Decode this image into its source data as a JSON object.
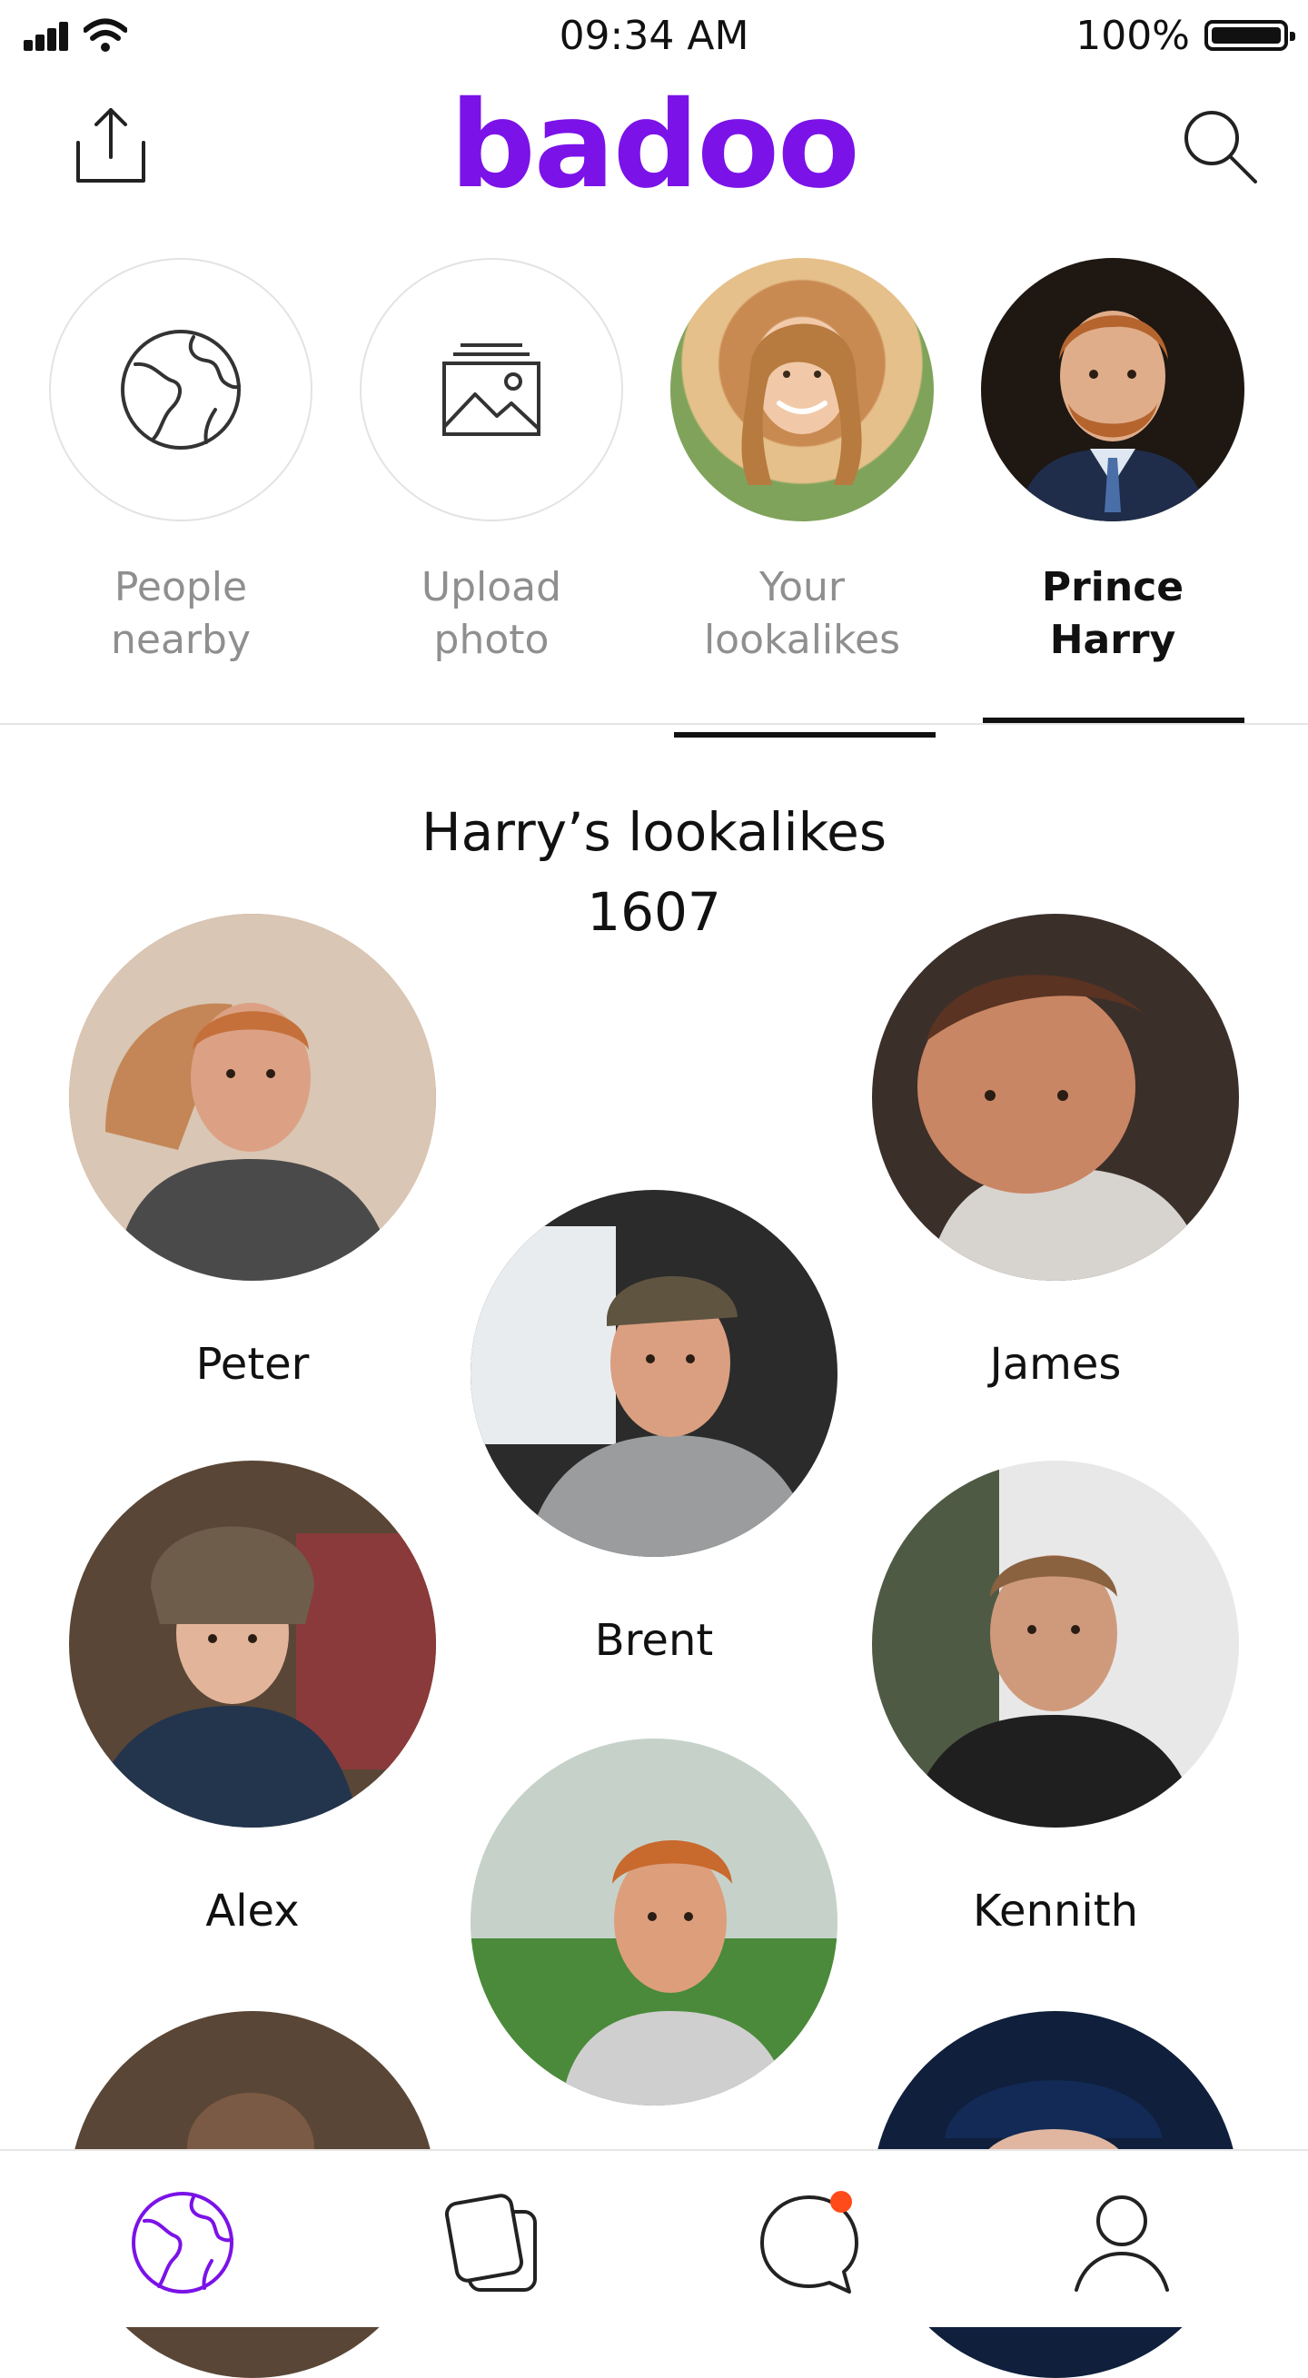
{
  "status_bar": {
    "time": "09:34 AM",
    "battery": "100%"
  },
  "header": {
    "logo": "badoo",
    "share_icon": "share-icon",
    "search_icon": "search-icon",
    "brand_color": "#7b12e8"
  },
  "stories": [
    {
      "label_line1": "People",
      "label_line2": "nearby",
      "icon": "globe-icon"
    },
    {
      "label_line1": "Upload",
      "label_line2": "photo",
      "icon": "photo-stack-icon"
    },
    {
      "label_line1": "Your",
      "label_line2": "lookalikes",
      "icon": "avatar-photo"
    },
    {
      "label_line1": "Prince",
      "label_line2": "Harry",
      "icon": "avatar-photo",
      "active": true
    }
  ],
  "section": {
    "title": "Harry’s lookalikes",
    "count": "1607"
  },
  "people": [
    {
      "name": "Peter"
    },
    {
      "name": "James"
    },
    {
      "name": "Brent"
    },
    {
      "name": "Alex"
    },
    {
      "name": "Kennith"
    },
    {
      "name": ""
    },
    {
      "name": ""
    },
    {
      "name": ""
    }
  ],
  "bottom_nav": [
    {
      "icon": "globe-icon",
      "active": true
    },
    {
      "icon": "cards-icon"
    },
    {
      "icon": "chat-icon",
      "badge": true
    },
    {
      "icon": "profile-icon"
    }
  ],
  "colors": {
    "accent": "#7b12e8",
    "notification": "#ff4a1a"
  }
}
